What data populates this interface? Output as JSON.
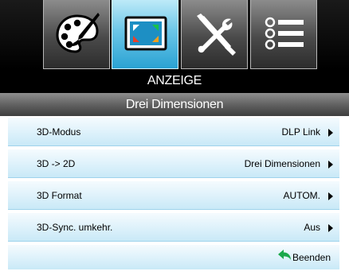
{
  "tabs": [
    {
      "icon": "palette-icon",
      "active": false
    },
    {
      "icon": "display-icon",
      "active": true
    },
    {
      "icon": "tools-icon",
      "active": false
    },
    {
      "icon": "list-icon",
      "active": false
    }
  ],
  "menu": {
    "title": "ANZEIGE",
    "submenu_title": "Drei Dimensionen"
  },
  "rows": [
    {
      "label": "3D-Modus",
      "value": "DLP Link"
    },
    {
      "label": "3D -> 2D",
      "value": "Drei Dimensionen"
    },
    {
      "label": "3D Format",
      "value": "AUTOM."
    },
    {
      "label": "3D-Sync. umkehr.",
      "value": "Aus"
    }
  ],
  "exit": {
    "label": "Beenden",
    "icon": "return-arrow-icon"
  },
  "colors": {
    "active_tab": "#2aa2d3",
    "row_background": "#dff2fb",
    "exit_arrow": "#1aa84a"
  }
}
